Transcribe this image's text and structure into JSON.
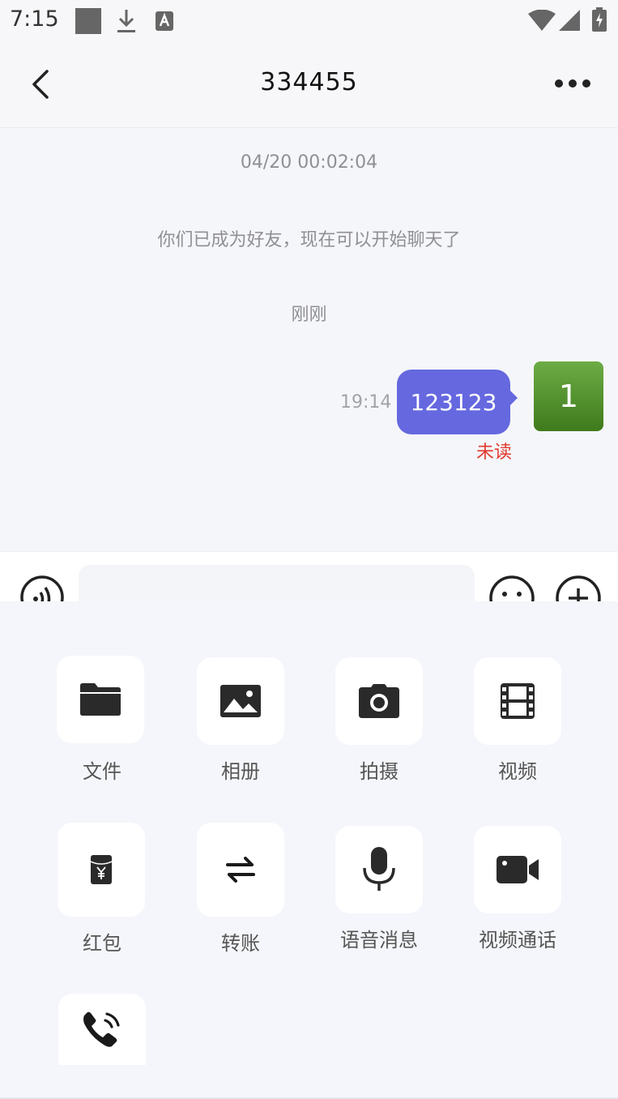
{
  "status_bar": {
    "time": "7:15",
    "icons": [
      "notification-square-icon",
      "download-icon",
      "keyboard-a-icon",
      "wifi-icon",
      "signal-icon",
      "battery-charging-icon"
    ]
  },
  "header": {
    "title": "334455",
    "back_icon": "chevron-left-icon",
    "more_icon": "more-dots-icon"
  },
  "chat": {
    "timestamp_date": "04/20 00:02:04",
    "friend_notice": "你们已成为好友，现在可以开始聊天了",
    "timestamp_now": "刚刚",
    "messages": [
      {
        "time": "19:14",
        "text": "123123",
        "status": "未读",
        "avatar_text": "1",
        "bubble_color": "#6568df",
        "status_color": "#e03b2f"
      }
    ]
  },
  "input_bar": {
    "voice_icon": "voice-input-icon",
    "input_value": "",
    "emoji_icon": "emoji-icon",
    "plus_icon": "plus-icon"
  },
  "panel": {
    "items": [
      {
        "label": "文件",
        "icon": "folder-icon"
      },
      {
        "label": "相册",
        "icon": "image-icon"
      },
      {
        "label": "拍摄",
        "icon": "camera-icon"
      },
      {
        "label": "视频",
        "icon": "film-icon"
      },
      {
        "label": "红包",
        "icon": "red-envelope-icon"
      },
      {
        "label": "转账",
        "icon": "transfer-icon"
      },
      {
        "label": "语音消息",
        "icon": "microphone-icon"
      },
      {
        "label": "视频通话",
        "icon": "video-camera-icon"
      },
      {
        "label": "",
        "icon": "phone-call-icon"
      }
    ]
  }
}
